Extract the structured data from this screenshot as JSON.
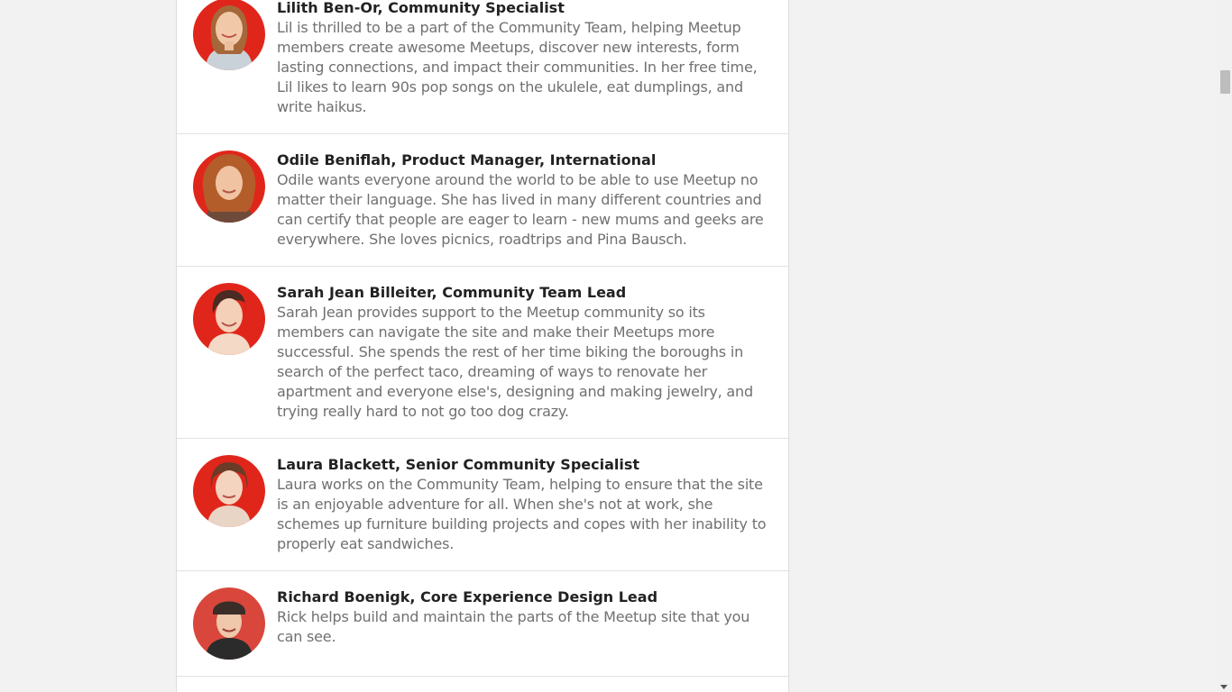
{
  "members": [
    {
      "name": "Lilith Ben-Or, Community Specialist",
      "bio": "Lil is thrilled to be a part of the Community Team, helping Meetup members create awesome Meetups, discover new interests, form lasting connections, and impact their communities. In her free time, Lil likes to learn 90s pop songs on the ukulele, eat dumplings, and write haikus."
    },
    {
      "name": "Odile Beniflah, Product Manager, International",
      "bio": "Odile wants everyone around the world to be able to use Meetup no matter their language. She has lived in many different countries and can certify that people are eager to learn - new mums and geeks are everywhere. She loves picnics, roadtrips and Pina Bausch."
    },
    {
      "name": "Sarah Jean Billeiter, Community Team Lead",
      "bio": "Sarah Jean provides support to the Meetup community so its members can navigate the site and make their Meetups more successful. She spends the rest of her time biking the boroughs in search of the perfect taco, dreaming of ways to renovate her apartment and everyone else's, designing and making jewelry, and trying really hard to not go too dog crazy."
    },
    {
      "name": "Laura Blackett, Senior Community Specialist",
      "bio": "Laura works on the Community Team, helping to ensure that the site is an enjoyable adventure for all. When she's not at work, she schemes up furniture building projects and copes with her inability to properly eat sandwiches."
    },
    {
      "name": "Richard Boenigk, Core Experience Design Lead",
      "bio": "Rick helps build and maintain the parts of the Meetup site that you can see."
    }
  ],
  "colors": {
    "avatar_background": "#e0261b",
    "name_text": "#222222",
    "bio_text": "#707070"
  }
}
